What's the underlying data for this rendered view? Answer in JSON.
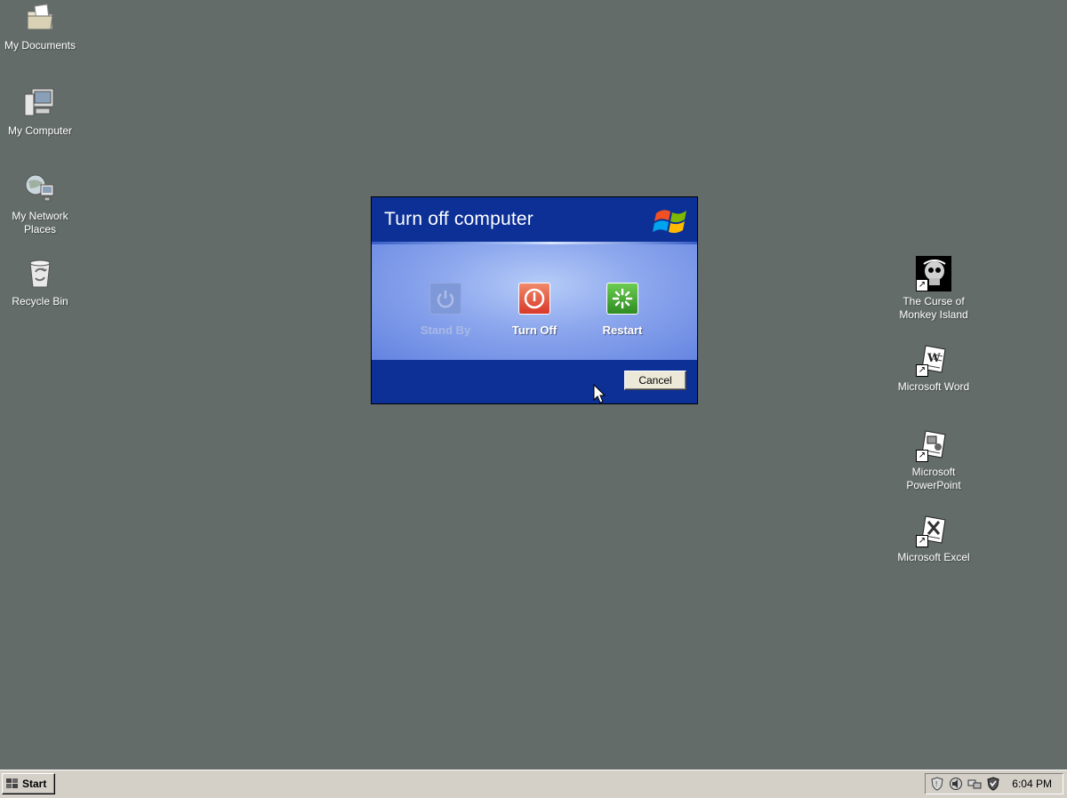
{
  "desktop": {
    "background": "#636c68",
    "left_icons": [
      {
        "label": "My Documents",
        "icon": "folder-icon"
      },
      {
        "label": "My Computer",
        "icon": "computer-icon"
      },
      {
        "label": "My Network Places",
        "icon": "network-icon"
      },
      {
        "label": "Recycle Bin",
        "icon": "recycle-bin-icon"
      }
    ],
    "right_icons": [
      {
        "label": "The Curse of Monkey Island",
        "icon": "skull-game-icon"
      },
      {
        "label": "Microsoft Word",
        "icon": "word-document-icon"
      },
      {
        "label": "Microsoft PowerPoint",
        "icon": "powerpoint-document-icon"
      },
      {
        "label": "Microsoft Excel",
        "icon": "excel-document-icon"
      }
    ]
  },
  "dialog": {
    "title": "Turn off computer",
    "buttons": [
      {
        "label": "Stand By",
        "enabled": false,
        "color": "#7f98d8"
      },
      {
        "label": "Turn Off",
        "enabled": true,
        "color": "#d8382a"
      },
      {
        "label": "Restart",
        "enabled": true,
        "color": "#2f8c22"
      }
    ],
    "cancel_label": "Cancel"
  },
  "taskbar": {
    "start_label": "Start",
    "tray_icons": [
      "security-shield-icon",
      "speaker-icon",
      "network-connection-icon",
      "antivirus-icon"
    ],
    "clock": "6:04 PM"
  }
}
